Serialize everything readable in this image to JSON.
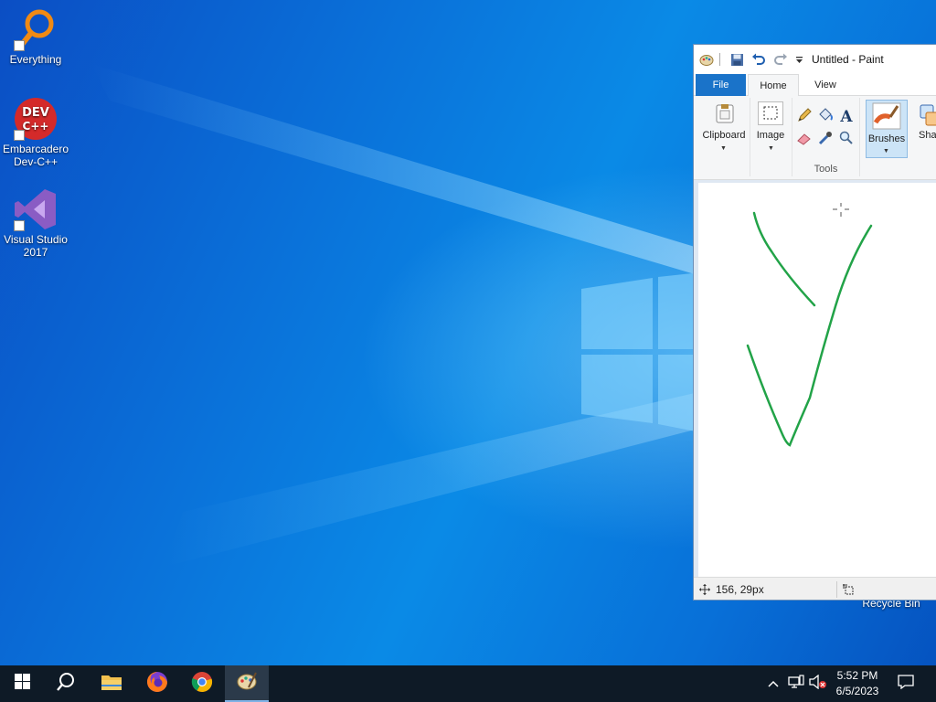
{
  "desktop": {
    "icons": [
      {
        "label": "Everything"
      },
      {
        "label": "Embarcadero Dev-C++"
      },
      {
        "label": "Visual Studio 2017"
      }
    ],
    "recycle_bin_label": "Recycle Bin"
  },
  "paint": {
    "title": "Untitled - Paint",
    "tabs": {
      "file": "File",
      "home": "Home",
      "view": "View"
    },
    "ribbon": {
      "clipboard": "Clipboard",
      "image": "Image",
      "tools_group": "Tools",
      "brushes": "Brushes",
      "shapes_partial": "Sha"
    },
    "status": {
      "coords": "156, 29px"
    },
    "colors": {
      "stroke": "#22a348",
      "accent": "#1a73c9"
    }
  },
  "taskbar": {
    "clock_time": "5:52 PM",
    "clock_date": "6/5/2023",
    "apps": [
      "start-icon",
      "search-icon",
      "file-explorer-icon",
      "firefox-icon",
      "chrome-icon",
      "paint-icon"
    ]
  }
}
